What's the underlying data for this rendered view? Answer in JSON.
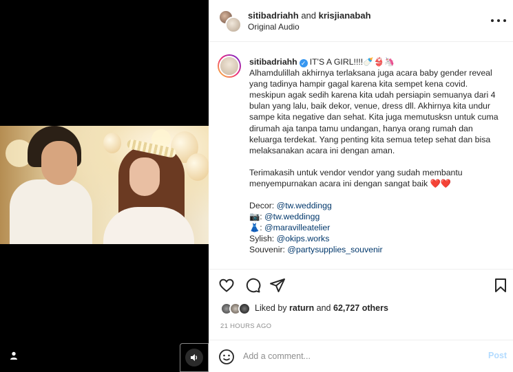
{
  "header": {
    "user1": "sitibadriahh",
    "joiner": "and",
    "user2": "krisjianabah",
    "audio": "Original Audio",
    "more_icon": "more-dots-icon"
  },
  "caption": {
    "username": "sitibadriahh",
    "title": "IT'S A GIRL!!!!",
    "title_emojis": "🍼👙🦄",
    "body": "Alhamdulillah akhirnya terlaksana juga acara baby gender reveal yang tadinya hampir gagal karena kita sempet kena covid. meskipun agak sedih karena kita udah persiapin semuanya dari 4 bulan yang lalu, baik dekor, venue, dress dll. Akhirnya kita undur sampe kita negative dan sehat. Kita juga memutusksn untuk cuma dirumah aja tanpa tamu undangan, hanya orang rumah dan keluarga terdekat. Yang penting kita semua tetep sehat dan bisa melaksanakan acara ini dengan aman.",
    "thanks": "Terimakasih untuk vendor vendor yang sudah membantu menyempurnakan acara ini dengan sangat baik",
    "thanks_emojis": "❤️❤️",
    "credits": [
      {
        "label": "Decor: ",
        "handle": "@tw.weddingg"
      },
      {
        "label": "📷: ",
        "handle": "@tw.weddingg"
      },
      {
        "label": "👗: ",
        "handle": "@maravilleatelier"
      },
      {
        "label": "Sylish: ",
        "handle": "@okips.works"
      },
      {
        "label": "Souvenir: ",
        "handle": "@partysupplies_souvenir"
      }
    ]
  },
  "likes": {
    "prefix": "Liked by",
    "user": "raturn",
    "joiner": "and",
    "count": "62,727 others"
  },
  "timestamp": "21 HOURS AGO",
  "comment": {
    "placeholder": "Add a comment...",
    "post_label": "Post"
  },
  "colors": {
    "link": "#00376b",
    "post_disabled": "#b3dbff",
    "verified": "#3897f0"
  }
}
